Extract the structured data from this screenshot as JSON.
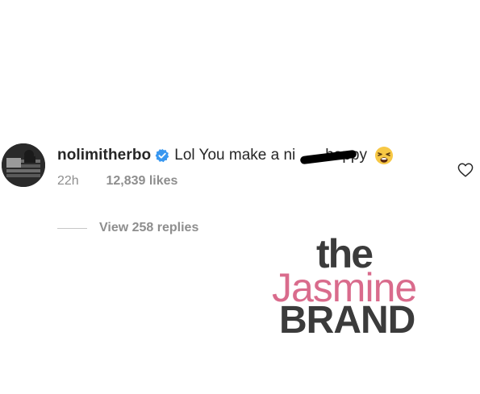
{
  "comment": {
    "username": "nolimitherbo",
    "verified_icon": "verified-badge-icon",
    "text": "Lol You make a ni       happy",
    "emoji_icon": "weary-face-emoji",
    "time": "22h",
    "likes": "12,839 likes",
    "like_icon": "heart-outline-icon"
  },
  "replies": {
    "label": "View 258 replies"
  },
  "watermark": {
    "the": "the",
    "jasmine": "Jasmine",
    "brand": "BRAND",
    "colors": {
      "dark": "#3b3b3b",
      "pink": "#d96b8c"
    }
  },
  "colors": {
    "verified": "#3897f0",
    "meta": "#8e8e8e",
    "text": "#262626"
  }
}
